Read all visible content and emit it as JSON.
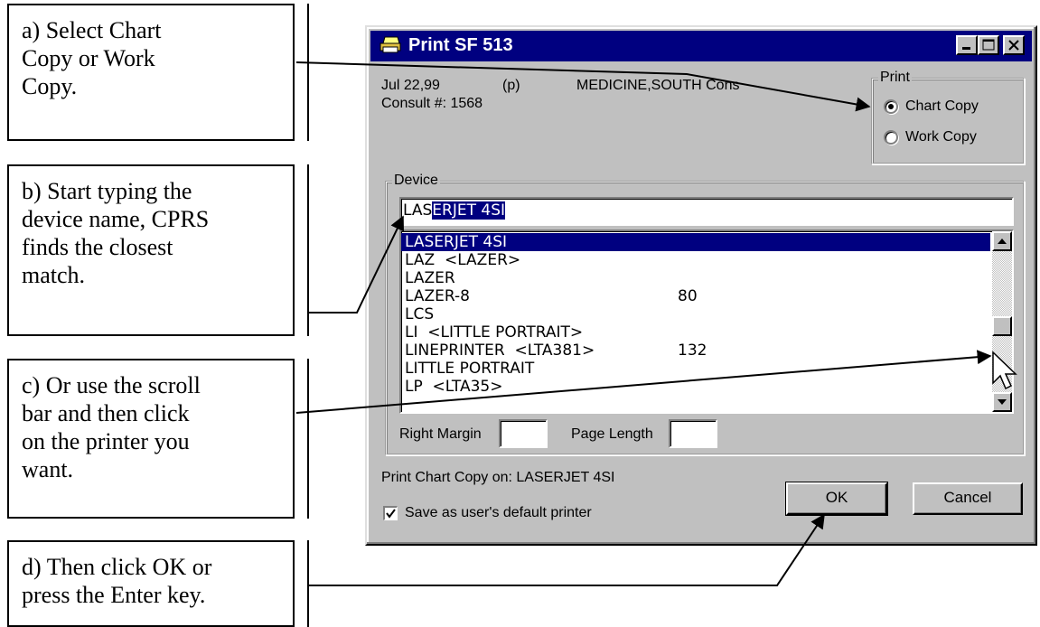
{
  "callouts": [
    {
      "text": "a) Select Chart\nCopy or Work\nCopy."
    },
    {
      "text": "b) Start typing the\ndevice name, CPRS\nfinds the closest\nmatch."
    },
    {
      "text": "c) Or use the scroll\nbar and then click\non the printer you\nwant."
    },
    {
      "text": "d) Then click OK or\npress the Enter key."
    }
  ],
  "dialog": {
    "title": "Print SF 513",
    "date": "Jul 22,99",
    "flag": "(p)",
    "service": "MEDICINE,SOUTH Cons",
    "consult": "Consult #: 1568",
    "print_group": {
      "label": "Print",
      "options": [
        {
          "label": "Chart Copy",
          "checked": true
        },
        {
          "label": "Work Copy",
          "checked": false
        }
      ]
    },
    "device_group": {
      "label": "Device",
      "input_typed": "LAS",
      "input_completion": "ERJET 4SI",
      "list": [
        {
          "name": "LASERJET 4SI",
          "value": "",
          "selected": true
        },
        {
          "name": "LAZ  <LAZER>",
          "value": ""
        },
        {
          "name": "LAZER",
          "value": ""
        },
        {
          "name": "LAZER-8",
          "value": "80"
        },
        {
          "name": "LCS",
          "value": ""
        },
        {
          "name": "LI  <LITTLE PORTRAIT>",
          "value": ""
        },
        {
          "name": "LINEPRINTER  <LTA381>",
          "value": "132"
        },
        {
          "name": "LITTLE PORTRAIT",
          "value": ""
        },
        {
          "name": "LP  <LTA35>",
          "value": ""
        }
      ],
      "right_margin_label": "Right Margin",
      "right_margin_value": "",
      "page_length_label": "Page Length",
      "page_length_value": ""
    },
    "status": "Print Chart Copy on:  LASERJET 4SI",
    "save_default_label": "Save as user's default printer",
    "save_default_checked": true,
    "ok_label": "OK",
    "cancel_label": "Cancel"
  },
  "icons": {
    "title_icon": "printer-icon",
    "minimize": "minimize-icon",
    "maximize": "maximize-icon",
    "close": "close-icon",
    "scroll_up": "arrow-up-icon",
    "scroll_down": "arrow-down-icon",
    "cursor": "mouse-pointer-icon"
  },
  "colors": {
    "titlebar": "#000080",
    "selection": "#000080",
    "dialog_face": "#c0c0c0"
  }
}
